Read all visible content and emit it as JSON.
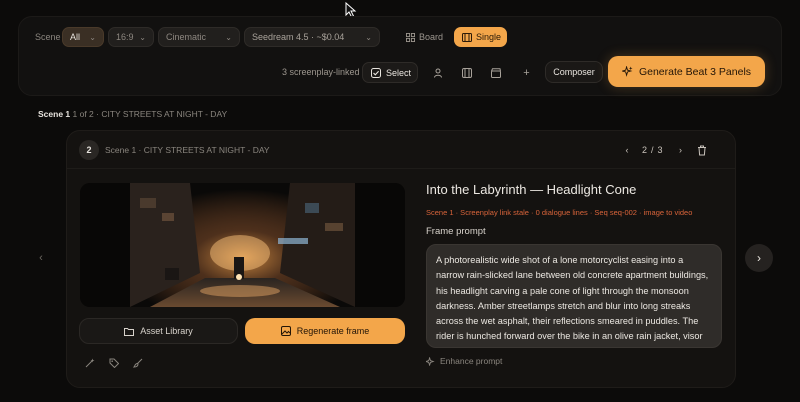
{
  "toolbar": {
    "scene_label": "Scene",
    "filter_scene": "All",
    "filter_ratio": "16:9",
    "filter_style": "Cinematic",
    "filter_model": "Seedream 4.5 · ~$0.04",
    "view_board": "Board",
    "view_single": "Single",
    "linked_count": "3 screenplay-linked",
    "select_label": "Select",
    "composer_label": "Composer",
    "generate_label": "Generate Beat 3 Panels"
  },
  "breadcrumb": {
    "scene": "Scene 1",
    "position": "1 of 2",
    "location": "· CITY STREETS AT NIGHT - DAY"
  },
  "card": {
    "number": "2",
    "subtitle": "Scene 1 · CITY STREETS AT NIGHT - DAY",
    "page_current": "2",
    "page_sep": "/",
    "page_total": "3",
    "title": "Into the Labyrinth — Headlight Cone",
    "meta": "Scene 1 · Screenplay link stale · 0 dialogue lines · Seq seq-002 · image to video",
    "frame_prompt_label": "Frame prompt",
    "frame_prompt": "A photorealistic wide shot of a lone motorcyclist easing into a narrow rain-slicked lane between old concrete apartment buildings, his headlight carving a pale cone of light through the monsoon darkness. Amber streetlamps stretch and blur into long streaks across the wet asphalt, their reflections smeared in puddles. The rider is hunched forward over the bike in an olive rain jacket, visor down, tail lights smeared red behind the",
    "asset_library_label": "Asset Library",
    "regenerate_label": "Regenerate frame",
    "enhance_label": "Enhance prompt"
  },
  "colors": {
    "accent": "#f3a64a",
    "meta": "#d9643a",
    "background": "#0c0b0a"
  }
}
